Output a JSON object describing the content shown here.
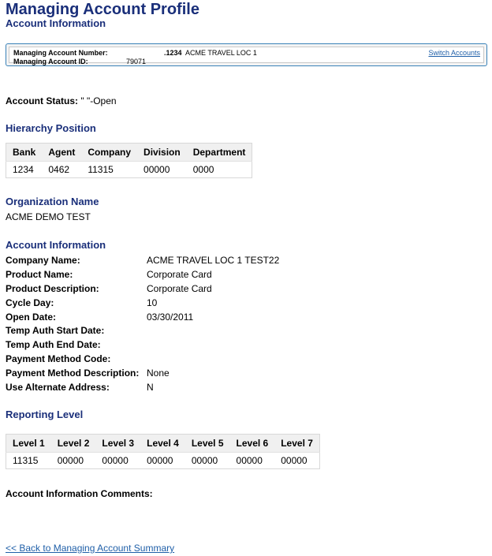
{
  "page": {
    "title": "Managing Account Profile",
    "subtitle": "Account Information"
  },
  "managing_account": {
    "number_label": "Managing Account Number:",
    "number_value": ".1234",
    "number_name": "ACME TRAVEL LOC 1",
    "id_label": "Managing Account ID:",
    "id_value": "79071",
    "switch_link": "Switch Accounts"
  },
  "status": {
    "label": "Account Status:",
    "value": "\" \"-Open"
  },
  "hierarchy": {
    "heading": "Hierarchy Position",
    "headers": [
      "Bank",
      "Agent",
      "Company",
      "Division",
      "Department"
    ],
    "values": [
      "1234",
      "0462",
      "11315",
      "00000",
      "0000"
    ]
  },
  "organization": {
    "heading": "Organization Name",
    "value": "ACME DEMO TEST"
  },
  "account_info": {
    "heading": "Account Information",
    "rows": [
      {
        "label": "Company Name:",
        "value": "ACME TRAVEL LOC 1 TEST22"
      },
      {
        "label": "Product Name:",
        "value": "Corporate Card"
      },
      {
        "label": "Product Description:",
        "value": "Corporate Card"
      },
      {
        "label": "Cycle Day:",
        "value": "10"
      },
      {
        "label": "Open Date:",
        "value": "03/30/2011"
      },
      {
        "label": "Temp Auth Start Date:",
        "value": ""
      },
      {
        "label": "Temp Auth End Date:",
        "value": ""
      },
      {
        "label": "Payment Method Code:",
        "value": ""
      },
      {
        "label": "Payment Method Description:",
        "value": "None"
      },
      {
        "label": "Use Alternate Address:",
        "value": "N"
      }
    ]
  },
  "reporting": {
    "heading": "Reporting Level",
    "headers": [
      "Level 1",
      "Level 2",
      "Level 3",
      "Level 4",
      "Level 5",
      "Level 6",
      "Level 7"
    ],
    "values": [
      "11315",
      "00000",
      "00000",
      "00000",
      "00000",
      "00000",
      "00000"
    ]
  },
  "comments": {
    "label": "Account Information Comments:"
  },
  "footer": {
    "back_link": "<< Back to Managing Account Summary"
  },
  "colors": {
    "heading": "#1a2f7a",
    "link": "#1f5fa8",
    "box_border": "#3a82b8"
  }
}
